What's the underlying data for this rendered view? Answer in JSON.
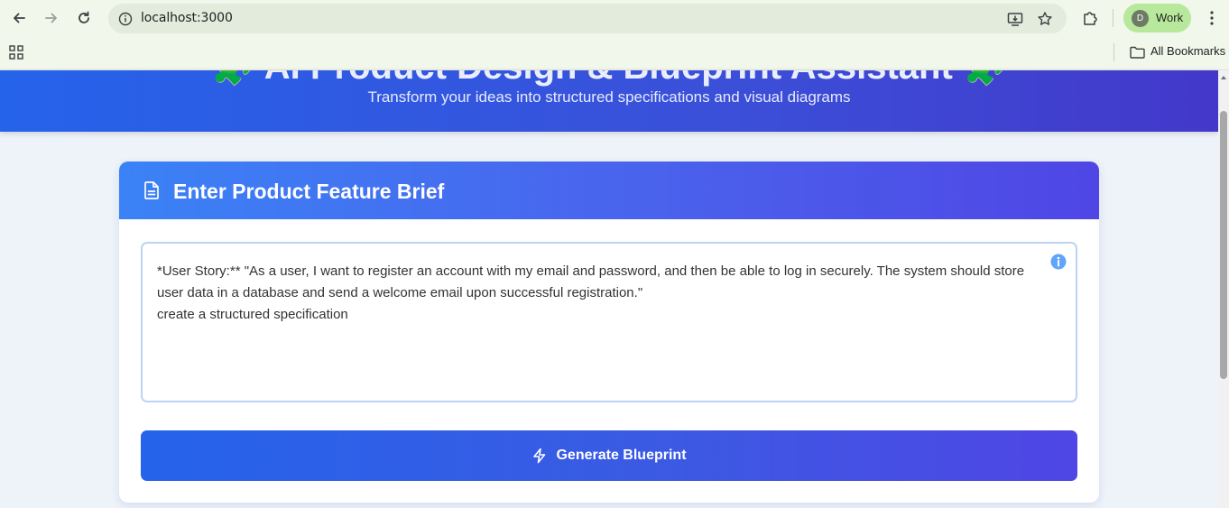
{
  "browser": {
    "url": "localhost:3000",
    "profile_initial": "D",
    "profile_name": "Work",
    "bookmarks_label": "All Bookmarks",
    "icons": [
      "back-icon",
      "forward-icon",
      "reload-icon",
      "site-info-icon",
      "install-app-icon",
      "star-icon",
      "extensions-icon",
      "menu-icon",
      "apps-grid-icon",
      "folder-icon"
    ]
  },
  "hero": {
    "title": "🧩 AI Product Design & Blueprint Assistant 🧩",
    "subtitle": "Transform your ideas into structured specifications and visual diagrams"
  },
  "brief_card": {
    "title": "Enter Product Feature Brief",
    "icon": "document-icon",
    "textarea_value": "*User Story:** \"As a user, I want to register an account with my email and password, and then be able to log in securely. The system should store user data in a database and send a welcome email upon successful registration.\"\ncreate a structured specification",
    "info_icon": "info-icon",
    "generate_label": "Generate Blueprint",
    "generate_icon": "lightning-icon"
  },
  "colors": {
    "accent_blue": "#2563eb",
    "accent_indigo": "#4f46e5",
    "page_bg": "#eef3fa",
    "chrome_bg": "#f1f7ea",
    "profile_bg": "#b7e89b"
  }
}
